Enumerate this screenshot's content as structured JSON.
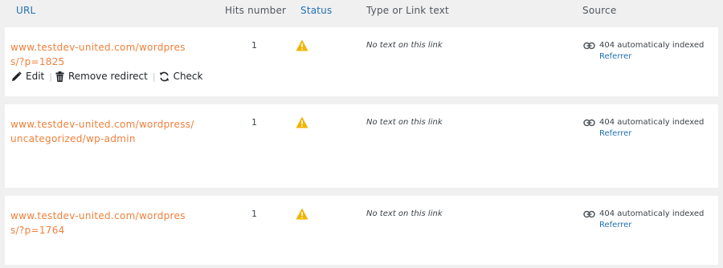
{
  "table": {
    "headers": {
      "url": "URL",
      "hits": "Hits number",
      "status": "Status",
      "type": "Type or Link text",
      "source": "Source"
    },
    "rows": [
      {
        "url": "www.testdev-united.com/wordpress/?p=1825",
        "hits": "1",
        "status_icon": "warning-icon",
        "type": "No text on this link",
        "source": "404 automaticaly indexed",
        "referrer": "Referrer",
        "actions": {
          "edit": "Edit",
          "remove": "Remove redirect",
          "check": "Check"
        }
      },
      {
        "url": "www.testdev-united.com/wordpress/uncategorized/wp-admin",
        "hits": "1",
        "status_icon": "warning-icon",
        "type": "No text on this link",
        "source": "404 automaticaly indexed",
        "referrer": "Referrer"
      },
      {
        "url": "www.testdev-united.com/wordpress/?p=1764",
        "hits": "1",
        "status_icon": "warning-icon",
        "type": "No text on this link",
        "source": "404 automaticaly indexed",
        "referrer": "Referrer"
      }
    ]
  },
  "colors": {
    "link_orange": "#f0803c",
    "header_blue": "#2271b1",
    "warning": "#f0b400"
  }
}
